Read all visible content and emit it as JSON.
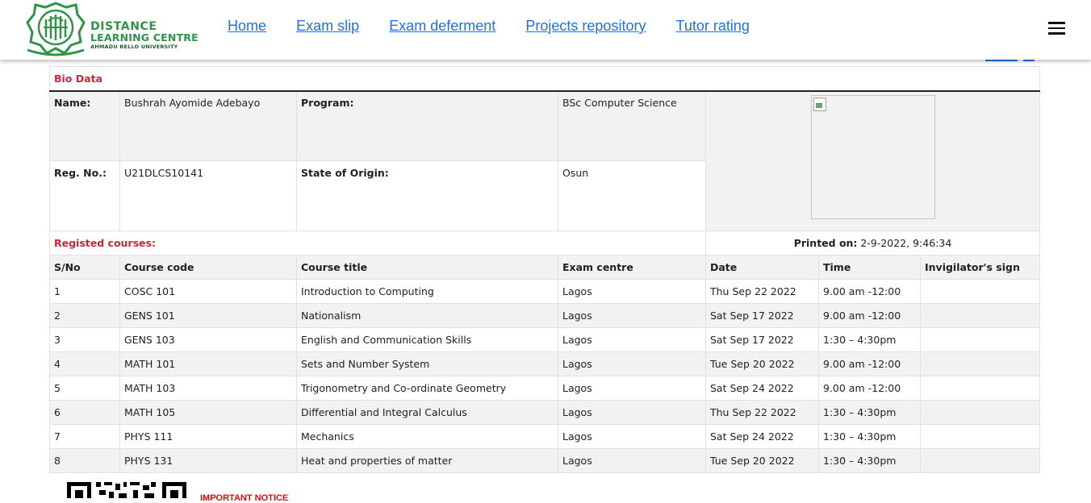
{
  "header": {
    "logo": {
      "line1": "DISTANCE",
      "line2": "LEARNING CENTRE",
      "line3": "AHMADU BELLO UNIVERSITY"
    },
    "nav": [
      "Home",
      "Exam slip",
      "Exam deferment",
      "Projects repository",
      "Tutor rating"
    ],
    "menu_icon": "hamburger-icon"
  },
  "bio": {
    "section_title": "Bio Data",
    "name_label": "Name:",
    "name_value": "Bushrah Ayomide Adebayo",
    "program_label": "Program:",
    "program_value": "BSc Computer Science",
    "reg_label": "Reg. No.:",
    "reg_value": "U21DLCS10141",
    "state_label": "State of Origin:",
    "state_value": "Osun",
    "photo_icon": "broken-image-icon"
  },
  "registration": {
    "title": "Registed courses:",
    "printed_label": "Printed on:",
    "printed_value": "2-9-2022, 9:46:34"
  },
  "courses": {
    "headers": [
      "S/No",
      "Course code",
      "Course title",
      "Exam centre",
      "Date",
      "Time",
      "Invigilator's sign"
    ],
    "rows": [
      {
        "sn": "1",
        "code": "COSC 101",
        "title": "Introduction to Computing",
        "centre": "Lagos",
        "date": "Thu Sep 22 2022",
        "time": "9.00 am -12:00",
        "sign": ""
      },
      {
        "sn": "2",
        "code": "GENS 101",
        "title": "Nationalism",
        "centre": "Lagos",
        "date": "Sat Sep 17 2022",
        "time": "9.00 am -12:00",
        "sign": ""
      },
      {
        "sn": "3",
        "code": "GENS 103",
        "title": "English and Communication Skills",
        "centre": "Lagos",
        "date": "Sat Sep 17 2022",
        "time": "1:30 – 4:30pm",
        "sign": ""
      },
      {
        "sn": "4",
        "code": "MATH 101",
        "title": "Sets and Number System",
        "centre": "Lagos",
        "date": "Tue Sep 20 2022",
        "time": "9.00 am -12:00",
        "sign": ""
      },
      {
        "sn": "5",
        "code": "MATH 103",
        "title": "Trigonometry and Co-ordinate Geometry",
        "centre": "Lagos",
        "date": "Sat Sep 24 2022",
        "time": "9.00 am -12:00",
        "sign": ""
      },
      {
        "sn": "6",
        "code": "MATH 105",
        "title": "Differential and Integral Calculus",
        "centre": "Lagos",
        "date": "Thu Sep 22 2022",
        "time": "1:30 – 4:30pm",
        "sign": ""
      },
      {
        "sn": "7",
        "code": "PHYS 111",
        "title": "Mechanics",
        "centre": "Lagos",
        "date": "Sat Sep 24 2022",
        "time": "1:30 – 4:30pm",
        "sign": ""
      },
      {
        "sn": "8",
        "code": "PHYS 131",
        "title": "Heat and properties of matter",
        "centre": "Lagos",
        "date": "Tue Sep 20 2022",
        "time": "1:30 – 4:30pm",
        "sign": ""
      }
    ]
  },
  "footer": {
    "notice": "IMPORTANT NOTICE",
    "qr_icon": "qr-code-icon"
  },
  "colors": {
    "accent_red": "#d2233c",
    "link_blue": "#1a73e8",
    "brand_green": "#2e9447"
  }
}
